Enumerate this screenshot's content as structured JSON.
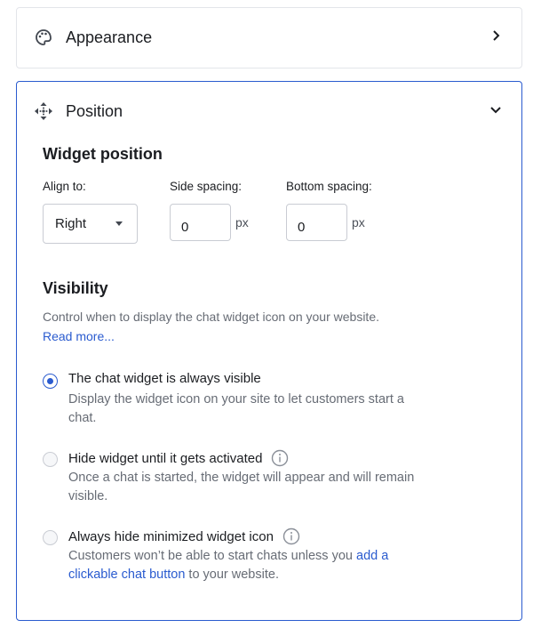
{
  "appearance": {
    "title": "Appearance",
    "icon": "palette-icon",
    "expanded": false
  },
  "position": {
    "title": "Position",
    "icon": "move-icon",
    "expanded": true,
    "widget_position": {
      "heading": "Widget position",
      "align_label": "Align to:",
      "align_value": "Right",
      "side_label": "Side spacing:",
      "side_value": "0",
      "side_unit": "px",
      "bottom_label": "Bottom spacing:",
      "bottom_value": "0",
      "bottom_unit": "px"
    },
    "visibility": {
      "heading": "Visibility",
      "description": "Control when to display the chat widget icon on your website.",
      "read_more": "Read more...",
      "options": [
        {
          "label": "The chat widget is always visible",
          "description": "Display the widget icon on your site to let customers start a chat.",
          "selected": true
        },
        {
          "label": "Hide widget until it gets activated",
          "description": "Once a chat is started, the widget will appear and will remain visible.",
          "selected": false
        },
        {
          "label": "Always hide minimized widget icon",
          "description_pre": "Customers won’t be able to start chats unless you ",
          "description_link": "add a clickable chat button",
          "description_post": " to your website.",
          "selected": false
        }
      ]
    }
  },
  "colors": {
    "accent": "#2a5bcf",
    "text": "#1b1d21",
    "muted": "#676c75"
  }
}
